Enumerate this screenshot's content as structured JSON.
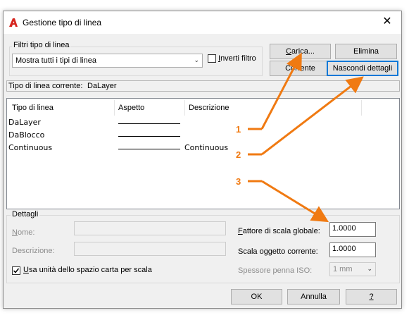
{
  "window": {
    "title": "Gestione tipo di linea",
    "close_glyph": "✕"
  },
  "filters": {
    "group_label": "Filtri tipo di linea",
    "selected": "Mostra tutti i tipi di linea",
    "invert_label": "Inverti filtro",
    "invert_checked": false
  },
  "buttons": {
    "load": "Carica...",
    "delete": "Elimina",
    "current": "Corrente",
    "hide_details": "Nascondi dettagli",
    "ok": "OK",
    "cancel": "Annulla",
    "help": "?"
  },
  "current_linetype": {
    "label": "Tipo di linea corrente:",
    "value": "DaLayer"
  },
  "table": {
    "columns": [
      "Tipo di linea",
      "Aspetto",
      "Descrizione"
    ],
    "rows": [
      {
        "name": "DaLayer",
        "description": ""
      },
      {
        "name": "DaBlocco",
        "description": ""
      },
      {
        "name": "Continuous",
        "description": "Continuous"
      }
    ]
  },
  "details": {
    "group_label": "Dettagli",
    "name_label": "Nome:",
    "name_value": "",
    "description_label": "Descrizione:",
    "description_value": "",
    "use_paper_space_label": "Usa unità dello spazio carta per scala",
    "use_paper_space_checked": true,
    "global_scale_label": "Fattore di scala globale:",
    "global_scale_value": "1.0000",
    "object_scale_label": "Scala oggetto corrente:",
    "object_scale_value": "1.0000",
    "iso_pen_label": "Spessore penna ISO:",
    "iso_pen_value": "1 mm"
  },
  "annotations": {
    "callout_1": "1",
    "callout_2": "2",
    "callout_3": "3",
    "color": "#f07a12"
  }
}
